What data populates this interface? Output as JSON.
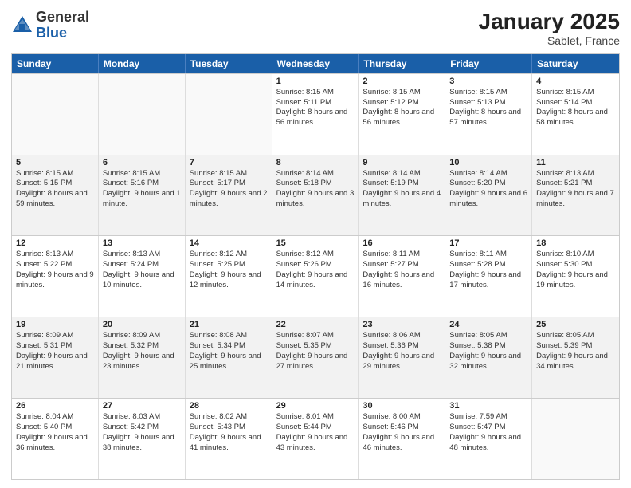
{
  "header": {
    "logo_general": "General",
    "logo_blue": "Blue",
    "month_title": "January 2025",
    "location": "Sablet, France"
  },
  "calendar": {
    "days": [
      "Sunday",
      "Monday",
      "Tuesday",
      "Wednesday",
      "Thursday",
      "Friday",
      "Saturday"
    ],
    "rows": [
      [
        {
          "day": "",
          "sunrise": "",
          "sunset": "",
          "daylight": "",
          "empty": true
        },
        {
          "day": "",
          "sunrise": "",
          "sunset": "",
          "daylight": "",
          "empty": true
        },
        {
          "day": "",
          "sunrise": "",
          "sunset": "",
          "daylight": "",
          "empty": true
        },
        {
          "day": "1",
          "sunrise": "Sunrise: 8:15 AM",
          "sunset": "Sunset: 5:11 PM",
          "daylight": "Daylight: 8 hours and 56 minutes."
        },
        {
          "day": "2",
          "sunrise": "Sunrise: 8:15 AM",
          "sunset": "Sunset: 5:12 PM",
          "daylight": "Daylight: 8 hours and 56 minutes."
        },
        {
          "day": "3",
          "sunrise": "Sunrise: 8:15 AM",
          "sunset": "Sunset: 5:13 PM",
          "daylight": "Daylight: 8 hours and 57 minutes."
        },
        {
          "day": "4",
          "sunrise": "Sunrise: 8:15 AM",
          "sunset": "Sunset: 5:14 PM",
          "daylight": "Daylight: 8 hours and 58 minutes."
        }
      ],
      [
        {
          "day": "5",
          "sunrise": "Sunrise: 8:15 AM",
          "sunset": "Sunset: 5:15 PM",
          "daylight": "Daylight: 8 hours and 59 minutes."
        },
        {
          "day": "6",
          "sunrise": "Sunrise: 8:15 AM",
          "sunset": "Sunset: 5:16 PM",
          "daylight": "Daylight: 9 hours and 1 minute."
        },
        {
          "day": "7",
          "sunrise": "Sunrise: 8:15 AM",
          "sunset": "Sunset: 5:17 PM",
          "daylight": "Daylight: 9 hours and 2 minutes."
        },
        {
          "day": "8",
          "sunrise": "Sunrise: 8:14 AM",
          "sunset": "Sunset: 5:18 PM",
          "daylight": "Daylight: 9 hours and 3 minutes."
        },
        {
          "day": "9",
          "sunrise": "Sunrise: 8:14 AM",
          "sunset": "Sunset: 5:19 PM",
          "daylight": "Daylight: 9 hours and 4 minutes."
        },
        {
          "day": "10",
          "sunrise": "Sunrise: 8:14 AM",
          "sunset": "Sunset: 5:20 PM",
          "daylight": "Daylight: 9 hours and 6 minutes."
        },
        {
          "day": "11",
          "sunrise": "Sunrise: 8:13 AM",
          "sunset": "Sunset: 5:21 PM",
          "daylight": "Daylight: 9 hours and 7 minutes."
        }
      ],
      [
        {
          "day": "12",
          "sunrise": "Sunrise: 8:13 AM",
          "sunset": "Sunset: 5:22 PM",
          "daylight": "Daylight: 9 hours and 9 minutes."
        },
        {
          "day": "13",
          "sunrise": "Sunrise: 8:13 AM",
          "sunset": "Sunset: 5:24 PM",
          "daylight": "Daylight: 9 hours and 10 minutes."
        },
        {
          "day": "14",
          "sunrise": "Sunrise: 8:12 AM",
          "sunset": "Sunset: 5:25 PM",
          "daylight": "Daylight: 9 hours and 12 minutes."
        },
        {
          "day": "15",
          "sunrise": "Sunrise: 8:12 AM",
          "sunset": "Sunset: 5:26 PM",
          "daylight": "Daylight: 9 hours and 14 minutes."
        },
        {
          "day": "16",
          "sunrise": "Sunrise: 8:11 AM",
          "sunset": "Sunset: 5:27 PM",
          "daylight": "Daylight: 9 hours and 16 minutes."
        },
        {
          "day": "17",
          "sunrise": "Sunrise: 8:11 AM",
          "sunset": "Sunset: 5:28 PM",
          "daylight": "Daylight: 9 hours and 17 minutes."
        },
        {
          "day": "18",
          "sunrise": "Sunrise: 8:10 AM",
          "sunset": "Sunset: 5:30 PM",
          "daylight": "Daylight: 9 hours and 19 minutes."
        }
      ],
      [
        {
          "day": "19",
          "sunrise": "Sunrise: 8:09 AM",
          "sunset": "Sunset: 5:31 PM",
          "daylight": "Daylight: 9 hours and 21 minutes."
        },
        {
          "day": "20",
          "sunrise": "Sunrise: 8:09 AM",
          "sunset": "Sunset: 5:32 PM",
          "daylight": "Daylight: 9 hours and 23 minutes."
        },
        {
          "day": "21",
          "sunrise": "Sunrise: 8:08 AM",
          "sunset": "Sunset: 5:34 PM",
          "daylight": "Daylight: 9 hours and 25 minutes."
        },
        {
          "day": "22",
          "sunrise": "Sunrise: 8:07 AM",
          "sunset": "Sunset: 5:35 PM",
          "daylight": "Daylight: 9 hours and 27 minutes."
        },
        {
          "day": "23",
          "sunrise": "Sunrise: 8:06 AM",
          "sunset": "Sunset: 5:36 PM",
          "daylight": "Daylight: 9 hours and 29 minutes."
        },
        {
          "day": "24",
          "sunrise": "Sunrise: 8:05 AM",
          "sunset": "Sunset: 5:38 PM",
          "daylight": "Daylight: 9 hours and 32 minutes."
        },
        {
          "day": "25",
          "sunrise": "Sunrise: 8:05 AM",
          "sunset": "Sunset: 5:39 PM",
          "daylight": "Daylight: 9 hours and 34 minutes."
        }
      ],
      [
        {
          "day": "26",
          "sunrise": "Sunrise: 8:04 AM",
          "sunset": "Sunset: 5:40 PM",
          "daylight": "Daylight: 9 hours and 36 minutes."
        },
        {
          "day": "27",
          "sunrise": "Sunrise: 8:03 AM",
          "sunset": "Sunset: 5:42 PM",
          "daylight": "Daylight: 9 hours and 38 minutes."
        },
        {
          "day": "28",
          "sunrise": "Sunrise: 8:02 AM",
          "sunset": "Sunset: 5:43 PM",
          "daylight": "Daylight: 9 hours and 41 minutes."
        },
        {
          "day": "29",
          "sunrise": "Sunrise: 8:01 AM",
          "sunset": "Sunset: 5:44 PM",
          "daylight": "Daylight: 9 hours and 43 minutes."
        },
        {
          "day": "30",
          "sunrise": "Sunrise: 8:00 AM",
          "sunset": "Sunset: 5:46 PM",
          "daylight": "Daylight: 9 hours and 46 minutes."
        },
        {
          "day": "31",
          "sunrise": "Sunrise: 7:59 AM",
          "sunset": "Sunset: 5:47 PM",
          "daylight": "Daylight: 9 hours and 48 minutes."
        },
        {
          "day": "",
          "sunrise": "",
          "sunset": "",
          "daylight": "",
          "empty": true
        }
      ]
    ]
  }
}
